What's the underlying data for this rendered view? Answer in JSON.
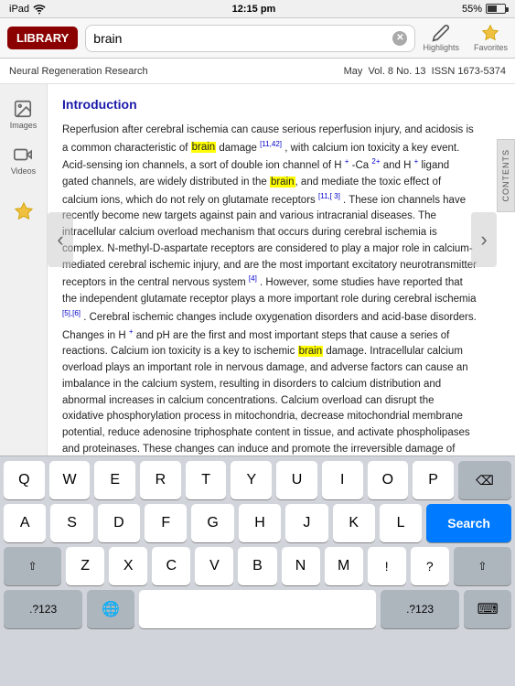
{
  "status_bar": {
    "device": "iPad",
    "wifi": true,
    "time": "12:15 pm",
    "battery_percent": "55%"
  },
  "top_nav": {
    "library_button": "LIBRARY",
    "search_value": "brain",
    "highlights_label": "Highlights",
    "favorites_label": "Favorites"
  },
  "journal_header": {
    "title": "Neural Regeneration Research",
    "date": "May",
    "volume": "Vol. 8 No. 13",
    "issn": "ISSN 1673-5374"
  },
  "sidebar": {
    "images_label": "Images",
    "videos_label": "Videos",
    "contents_label": "CONTENTS"
  },
  "article": {
    "heading": "Introduction",
    "body": "Reperfusion after cerebral ischemia can cause serious reperfusion injury, and acidosis is a common characteristic of brain damage [11,42] , with calcium ion toxicity a key event. Acid-sensing ion channels, a sort of double ion channel of H + -Ca 2+ and H + ligand gated channels, are widely distributed in the brain, and mediate the toxic effect of calcium ions, which do not rely on glutamate receptors [11,[ 3] . These ion channels have recently become new targets against pain and various intracranial diseases. The intracellular calcium overload mechanism that occurs during cerebral ischemia is complex. N-methyl-D-aspartate receptors are considered to play a major role in calcium-mediated cerebral ischemic injury, and are the most important excitatory neurotransmitter receptors in the central nervous system [4] . However, some studies have reported that the independent glutamate receptor plays a more important role during cerebral ischemia [5],[6] . Cerebral ischemic changes include oxygenation disorders and acid-base disorders. Changes in H + and pH are the first and most important steps that cause a series of reactions. Calcium ion toxicity is a key to ischemic brain damage. Intracellular calcium overload plays an important role in nervous damage, and adverse factors can cause an imbalance in the calcium system, resulting in disorders to calcium distribution and abnormal increases in calcium concentrations. Calcium overload can disrupt the oxidative phosphorylation process in mitochondria, decrease mitochondrial membrane potential, reduce adenosine triphosphate content in tissue, and activate phospholipases and proteinases. These changes can induce and promote the irreversible damage of cells. The above-mentioned results"
  },
  "keyboard": {
    "row1": [
      "Q",
      "W",
      "E",
      "R",
      "T",
      "Y",
      "U",
      "I",
      "O",
      "P"
    ],
    "row2": [
      "A",
      "S",
      "D",
      "F",
      "G",
      "H",
      "J",
      "K",
      "L"
    ],
    "row3": [
      "Z",
      "X",
      "C",
      "V",
      "B",
      "N",
      "M"
    ],
    "bottom_left": ".?123",
    "globe": "🌐",
    "space": "",
    "bottom_right": ".?123",
    "search_label": "Search",
    "shift_label": "⇧",
    "delete_label": "⌫",
    "keyboard_label": "⌨"
  },
  "nav_arrows": {
    "prev": "‹",
    "next": "›"
  }
}
